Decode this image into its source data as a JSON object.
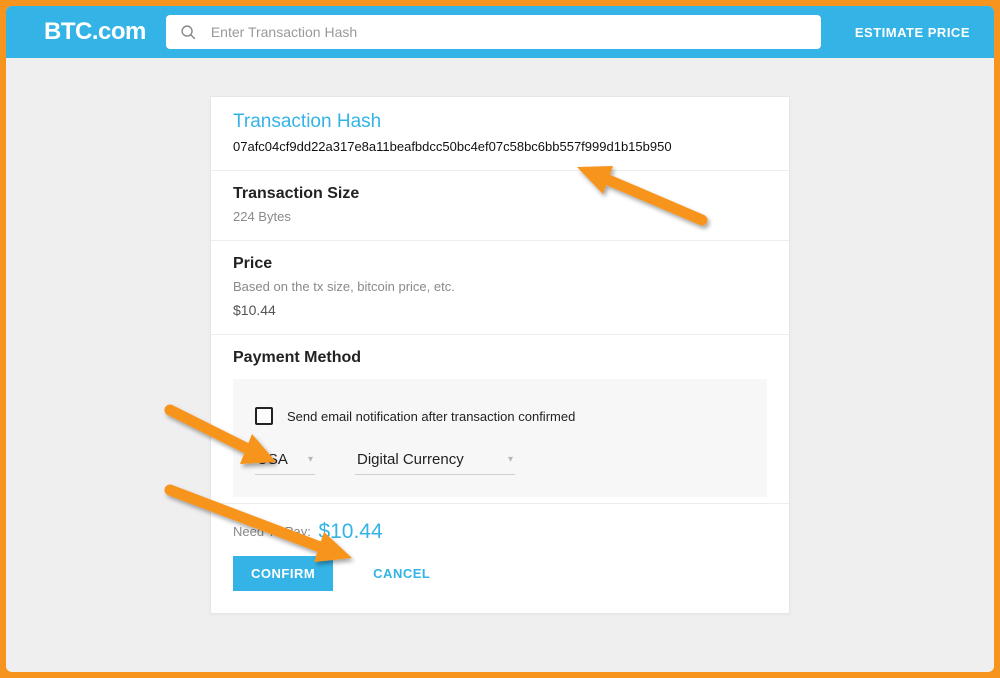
{
  "header": {
    "brand_main": "BTC",
    "brand_suffix": ".com",
    "search_placeholder": "Enter Transaction Hash",
    "estimate_label": "ESTIMATE PRICE"
  },
  "tx": {
    "hash_title": "Transaction Hash",
    "hash_value": "07afc04cf9dd22a317e8a11beafbdcc50bc4ef07c58bc6bb557f999d1b15b950",
    "size_title": "Transaction Size",
    "size_value": "224 Bytes",
    "price_title": "Price",
    "price_sub": "Based on the tx size, bitcoin price, etc.",
    "price_value": "$10.44"
  },
  "payment": {
    "title": "Payment Method",
    "notify_label": "Send email notification after transaction confirmed",
    "country_selected": "USA",
    "currency_selected": "Digital Currency"
  },
  "footer": {
    "need_label": "Need To Pay:",
    "amount": "$10.44",
    "confirm_label": "CONFIRM",
    "cancel_label": "CANCEL"
  },
  "colors": {
    "accent": "#34b4e6",
    "frame": "#f7941e"
  }
}
